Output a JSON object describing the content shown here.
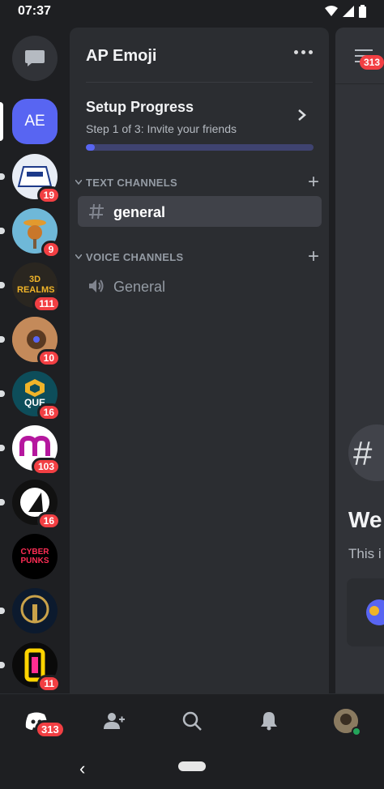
{
  "status_bar": {
    "time": "07:37"
  },
  "server_rail": {
    "items": [
      {
        "name": "direct-messages",
        "badge": ""
      },
      {
        "name": "AE",
        "label": "AE",
        "badge": ""
      },
      {
        "name": "server-1",
        "badge": "19",
        "color": "#e8edf5"
      },
      {
        "name": "server-2",
        "badge": "9",
        "color": "#6fb8d8"
      },
      {
        "name": "server-3",
        "label": "3D REALMS",
        "badge": "111",
        "color": "#2a2620"
      },
      {
        "name": "server-4",
        "badge": "10",
        "color": "#8a5a3a"
      },
      {
        "name": "server-5",
        "label": "QUE",
        "badge": "16",
        "color": "#0d4d5a"
      },
      {
        "name": "server-6",
        "badge": "103",
        "color": "#ffffff"
      },
      {
        "name": "server-7",
        "badge": "16",
        "color": "#111111"
      },
      {
        "name": "server-8",
        "label": "CYBER PUNKS",
        "badge": "",
        "color": "#000000"
      },
      {
        "name": "server-9",
        "badge": "",
        "color": "#0c1a2e"
      },
      {
        "name": "server-10",
        "badge": "11",
        "color": "#0a0a0a"
      }
    ]
  },
  "panel": {
    "server_name": "AP Emoji",
    "setup": {
      "title": "Setup Progress",
      "subtitle": "Step 1 of 3: Invite your friends",
      "progress": 0.04
    },
    "text_section": {
      "label": "TEXT CHANNELS"
    },
    "voice_section": {
      "label": "VOICE CHANNELS"
    },
    "text_channels": [
      {
        "name": "general"
      }
    ],
    "voice_channels": [
      {
        "name": "General"
      }
    ]
  },
  "main": {
    "badge": "313",
    "welcome_title": "We",
    "welcome_sub": "This i"
  },
  "bottom_nav": {
    "home_badge": "313"
  },
  "colors": {
    "accent": "#5865f2",
    "badge": "#f23f43",
    "online": "#23a55a"
  }
}
